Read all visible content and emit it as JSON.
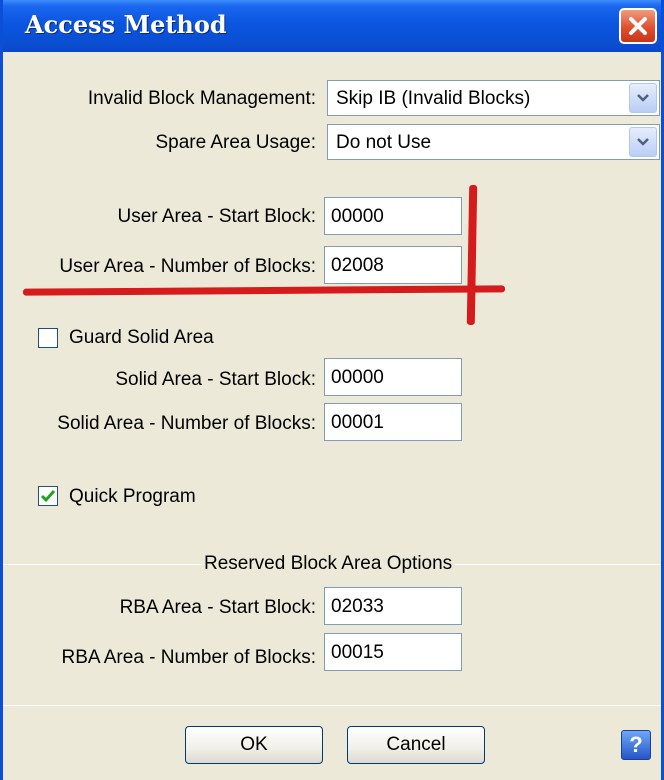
{
  "window": {
    "title": "Access Method"
  },
  "invalid_block": {
    "label": "Invalid Block Management:",
    "value": "Skip IB (Invalid Blocks)"
  },
  "spare_area": {
    "label": "Spare Area Usage:",
    "value": "Do not Use"
  },
  "user_area": {
    "start_label": "User Area - Start Block:",
    "start_value": "00000",
    "count_label": "User Area - Number of Blocks:",
    "count_value": "02008"
  },
  "guard_solid": {
    "label": "Guard Solid Area",
    "checked": false
  },
  "solid_area": {
    "start_label": "Solid Area - Start Block:",
    "start_value": "00000",
    "count_label": "Solid Area - Number of Blocks:",
    "count_value": "00001"
  },
  "quick_program": {
    "label": "Quick Program",
    "checked": true
  },
  "rba": {
    "group_title": "Reserved Block Area Options",
    "start_label": "RBA Area - Start Block:",
    "start_value": "02033",
    "count_label": "RBA Area - Number of Blocks:",
    "count_value": "00015"
  },
  "buttons": {
    "ok": "OK",
    "cancel": "Cancel",
    "help": "?"
  },
  "colors": {
    "annotation": "#d51b1b",
    "titlebar": "#0a4fd4"
  }
}
